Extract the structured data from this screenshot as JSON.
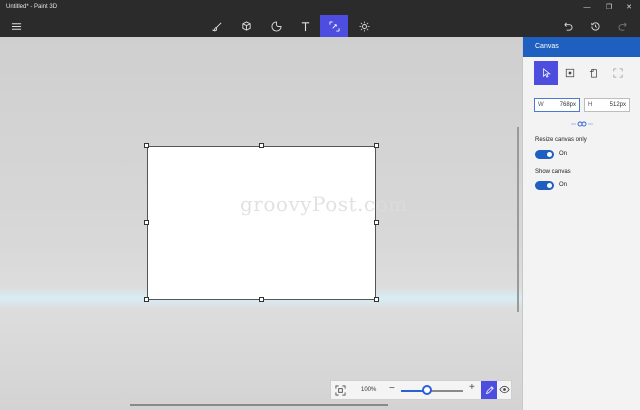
{
  "window": {
    "title": "Untitled* - Paint 3D"
  },
  "toolbar": {
    "tools": [
      "brushes",
      "3d-shapes",
      "stickers",
      "text",
      "canvas",
      "effects"
    ],
    "active_tool": "canvas"
  },
  "workspace": {
    "watermark": "groovyPost.com"
  },
  "zoom": {
    "level": "100%",
    "slider_fraction": 0.42
  },
  "panel": {
    "title": "Canvas",
    "width": {
      "label": "W",
      "value": "768px"
    },
    "height": {
      "label": "H",
      "value": "512px"
    },
    "resize_canvas_only": {
      "label": "Resize canvas only",
      "state": "On"
    },
    "show_canvas": {
      "label": "Show canvas",
      "state": "On"
    }
  },
  "colors": {
    "accent": "#4d4ddf",
    "panel_header": "#1f5fbf",
    "toggle": "#1f5fbf",
    "chrome": "#2b2b2b"
  }
}
